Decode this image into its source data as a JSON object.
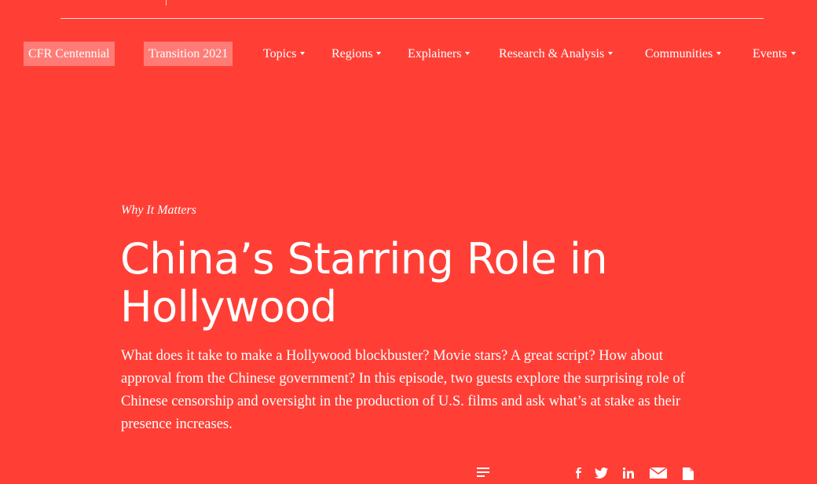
{
  "nav": {
    "pills": [
      {
        "label": "CFR Centennial"
      },
      {
        "label": "Transition 2021"
      }
    ],
    "items": [
      {
        "label": "Topics"
      },
      {
        "label": "Regions"
      },
      {
        "label": "Explainers"
      },
      {
        "label": "Research & Analysis"
      },
      {
        "label": "Communities"
      },
      {
        "label": "Events"
      }
    ]
  },
  "article": {
    "eyebrow": "Why It Matters",
    "title": "China’s Starring Role in Hollywood",
    "dek": "What does it take to make a Hollywood blockbuster? Movie stars? A great script? How about approval from the Chinese government? In this episode, two guests explore the surprising role of Chinese censorship and oversight in the production of U.S. films and ask what’s at stake as their presence increases."
  },
  "share": {
    "icons": [
      "transcript-icon",
      "facebook-icon",
      "twitter-icon",
      "linkedin-icon",
      "email-icon",
      "copy-icon"
    ]
  },
  "colors": {
    "background": "#ff3f36",
    "text": "#ffffff"
  }
}
